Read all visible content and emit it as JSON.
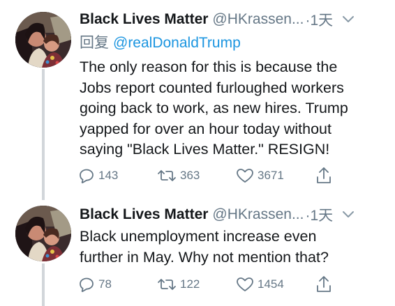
{
  "tweets": [
    {
      "display_name": "Black Lives Matter",
      "handle": "@HKrassen...",
      "time": "·1天",
      "reply_prefix": "回复",
      "reply_to": "@realDonaldTrump",
      "text": "The only reason for this is because the\nJobs report counted furloughed workers\ngoing back to work, as new hires.  Trump\nyapped for over an hour today without\nsaying \"Black Lives Matter.\"  RESIGN!",
      "replies": "143",
      "retweets": "363",
      "likes": "3671"
    },
    {
      "display_name": "Black Lives Matter",
      "handle": "@HKrassen...",
      "time": "·1天",
      "text": "Black unemployment increase even\nfurther in May.  Why not mention that?",
      "replies": "78",
      "retweets": "122",
      "likes": "1454"
    }
  ],
  "icons": {
    "caret": "chevron-down-icon",
    "reply": "reply-icon",
    "retweet": "retweet-icon",
    "like": "heart-icon",
    "share": "share-icon"
  },
  "colors": {
    "text": "#14171a",
    "secondary": "#657786",
    "link": "#1b95e0",
    "thread": "#d2d6da"
  }
}
